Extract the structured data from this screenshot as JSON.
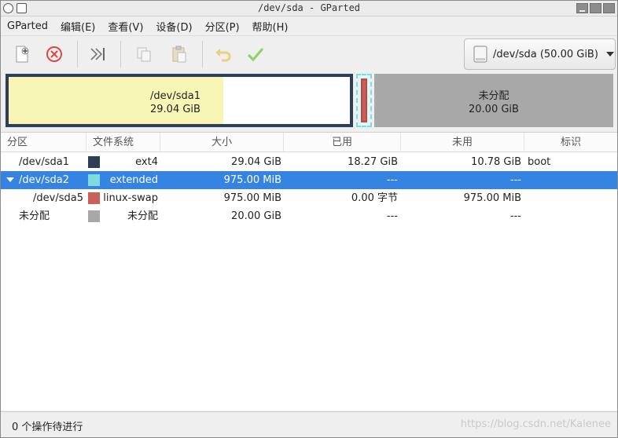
{
  "window": {
    "title": "/dev/sda - GParted"
  },
  "menu": [
    "GParted",
    "编辑(E)",
    "查看(V)",
    "设备(D)",
    "分区(P)",
    "帮助(H)"
  ],
  "toolbar": {
    "buttons": [
      "new-partition-icon",
      "delete-partition-icon",
      "resize-move-icon",
      "copy-icon",
      "paste-icon",
      "undo-icon",
      "apply-icon"
    ],
    "device_label": "/dev/sda (50.00 GiB)"
  },
  "map": {
    "sda1": {
      "name": "/dev/sda1",
      "size": "29.04 GiB",
      "used_fraction": 0.63
    },
    "unallocated": {
      "name": "未分配",
      "size": "20.00 GiB"
    }
  },
  "table": {
    "headers": [
      "分区",
      "文件系统",
      "大小",
      "已用",
      "未用",
      "标识"
    ],
    "rows": [
      {
        "partition": "/dev/sda1",
        "fs": "ext4",
        "fs_color": "#2d3e55",
        "size": "29.04 GiB",
        "used": "18.27 GiB",
        "unused": "10.78 GiB",
        "flags": "boot"
      },
      {
        "partition": "/dev/sda2",
        "fs": "extended",
        "fs_color": "#7fd9de",
        "size": "975.00 MiB",
        "used": "---",
        "unused": "---",
        "flags": ""
      },
      {
        "partition": "/dev/sda5",
        "fs": "linux-swap",
        "fs_color": "#c9605a",
        "size": "975.00 MiB",
        "used": "0.00 字节",
        "unused": "975.00 MiB",
        "flags": ""
      },
      {
        "partition": "未分配",
        "fs": "未分配",
        "fs_color": "#a8a8a8",
        "size": "20.00 GiB",
        "used": "---",
        "unused": "---",
        "flags": ""
      }
    ]
  },
  "status": {
    "text": "0 个操作待进行",
    "watermark": "https://blog.csdn.net/Kalenee"
  }
}
